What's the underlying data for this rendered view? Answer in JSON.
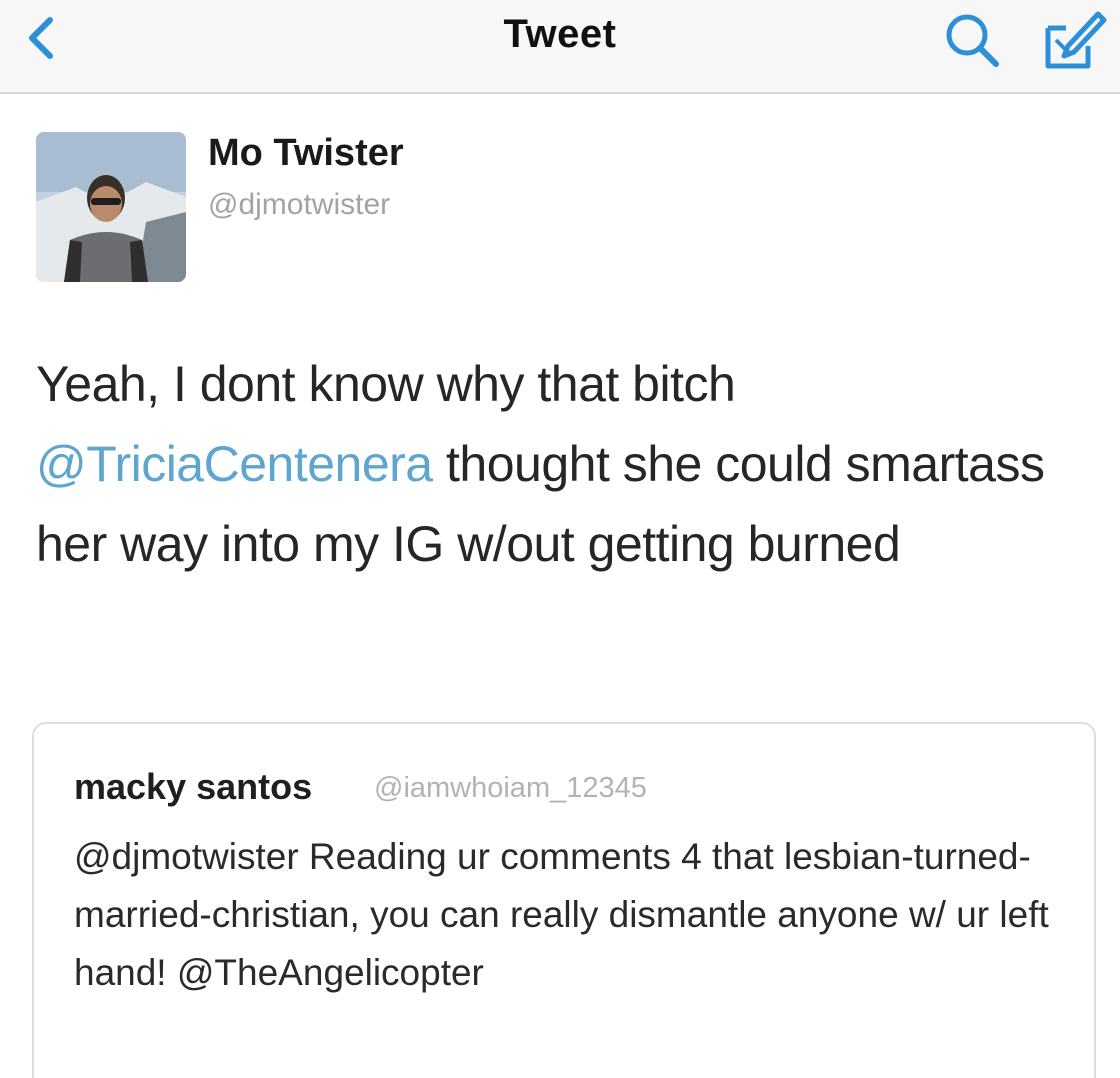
{
  "nav": {
    "title": "Tweet",
    "back_icon": "chevron-left-icon",
    "search_icon": "search-icon",
    "compose_icon": "compose-icon",
    "accent_color": "#2d8fd8"
  },
  "tweet": {
    "author_name": "Mo Twister",
    "author_handle": "@djmotwister",
    "text_part1": "Yeah, I dont know why that bitch ",
    "mention": "@TriciaCentenera",
    "text_part2": " thought she could smartass her way into my IG w/out getting burned",
    "mention_color": "#5fa6cf"
  },
  "quoted_tweet": {
    "author_name": "macky santos",
    "author_handle": "@iamwhoiam_12345",
    "text": "@djmotwister Reading ur comments 4 that lesbian-turned-married-christian, you can really dismantle anyone w/ ur left hand! @TheAngelicopter"
  }
}
